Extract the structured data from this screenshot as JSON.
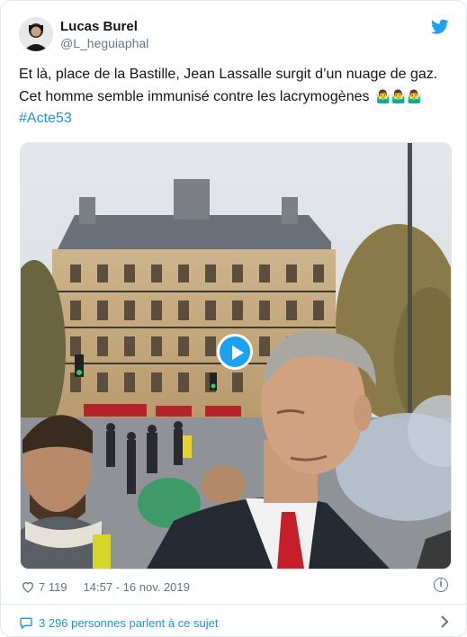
{
  "author": {
    "name": "Lucas Burel",
    "handle": "@L_heguiaphal"
  },
  "tweet": {
    "line1": "Et là, place de la Bastille, Jean Lassalle surgit d’un nuage de gaz.",
    "line2": "Cet homme semble immunisé contre les lacrymogènes",
    "emojis": "🤷‍♂️🤷‍♂️🤷‍♂️",
    "hashtag": "#Acte53"
  },
  "stats": {
    "likes": "7 119",
    "timestamp": "14:57 - 16 nov. 2019"
  },
  "footer": {
    "conversation": "3 296 personnes parlent à ce sujet"
  },
  "colors": {
    "link": "#1b95e0",
    "brand": "#1da1f2",
    "muted": "#657786"
  },
  "icons": [
    "twitter-bird-icon",
    "play-icon",
    "heart-icon",
    "info-icon",
    "speech-bubble-icon",
    "chevron-right-icon"
  ]
}
